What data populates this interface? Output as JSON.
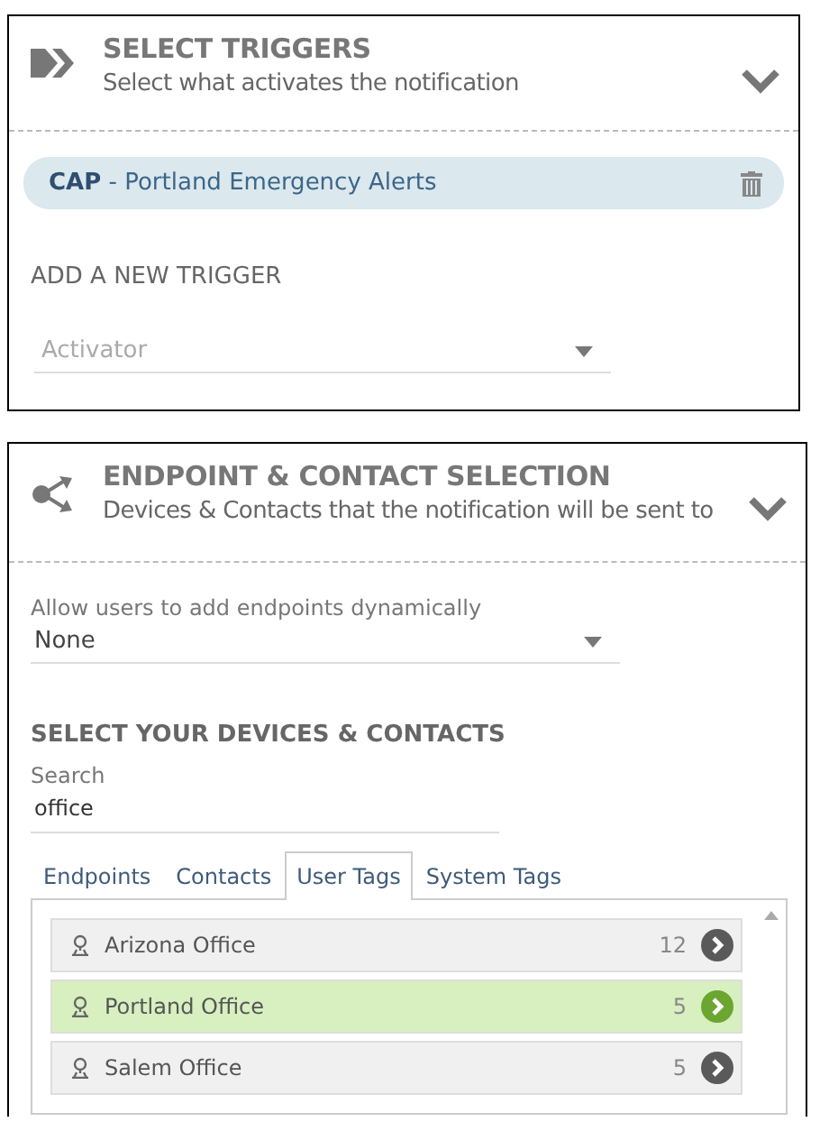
{
  "triggers_panel": {
    "title": "SELECT TRIGGERS",
    "subtitle": "Select what activates the notification",
    "expanded": true,
    "triggers": [
      {
        "code": "CAP",
        "separator": " - ",
        "name": "Portland Emergency Alerts"
      }
    ],
    "add_heading": "ADD A NEW TRIGGER",
    "activator": {
      "placeholder": "Activator"
    }
  },
  "endpoint_panel": {
    "title": "ENDPOINT & CONTACT SELECTION",
    "subtitle": "Devices & Contacts that the notification will be sent to",
    "expanded": true,
    "dynamic_label": "Allow users to add endpoints dynamically",
    "dynamic_value": "None",
    "section_heading": "SELECT YOUR DEVICES & CONTACTS",
    "search": {
      "label": "Search",
      "value": "office"
    },
    "tabs": [
      {
        "label": "Endpoints",
        "selected": false
      },
      {
        "label": "Contacts",
        "selected": false
      },
      {
        "label": "User Tags",
        "selected": true
      },
      {
        "label": "System Tags",
        "selected": false
      }
    ],
    "tags": [
      {
        "name": "Arizona Office",
        "count": "12",
        "selected": false
      },
      {
        "name": "Portland Office",
        "count": "5",
        "selected": true
      },
      {
        "name": "Salem Office",
        "count": "5",
        "selected": false
      }
    ]
  }
}
